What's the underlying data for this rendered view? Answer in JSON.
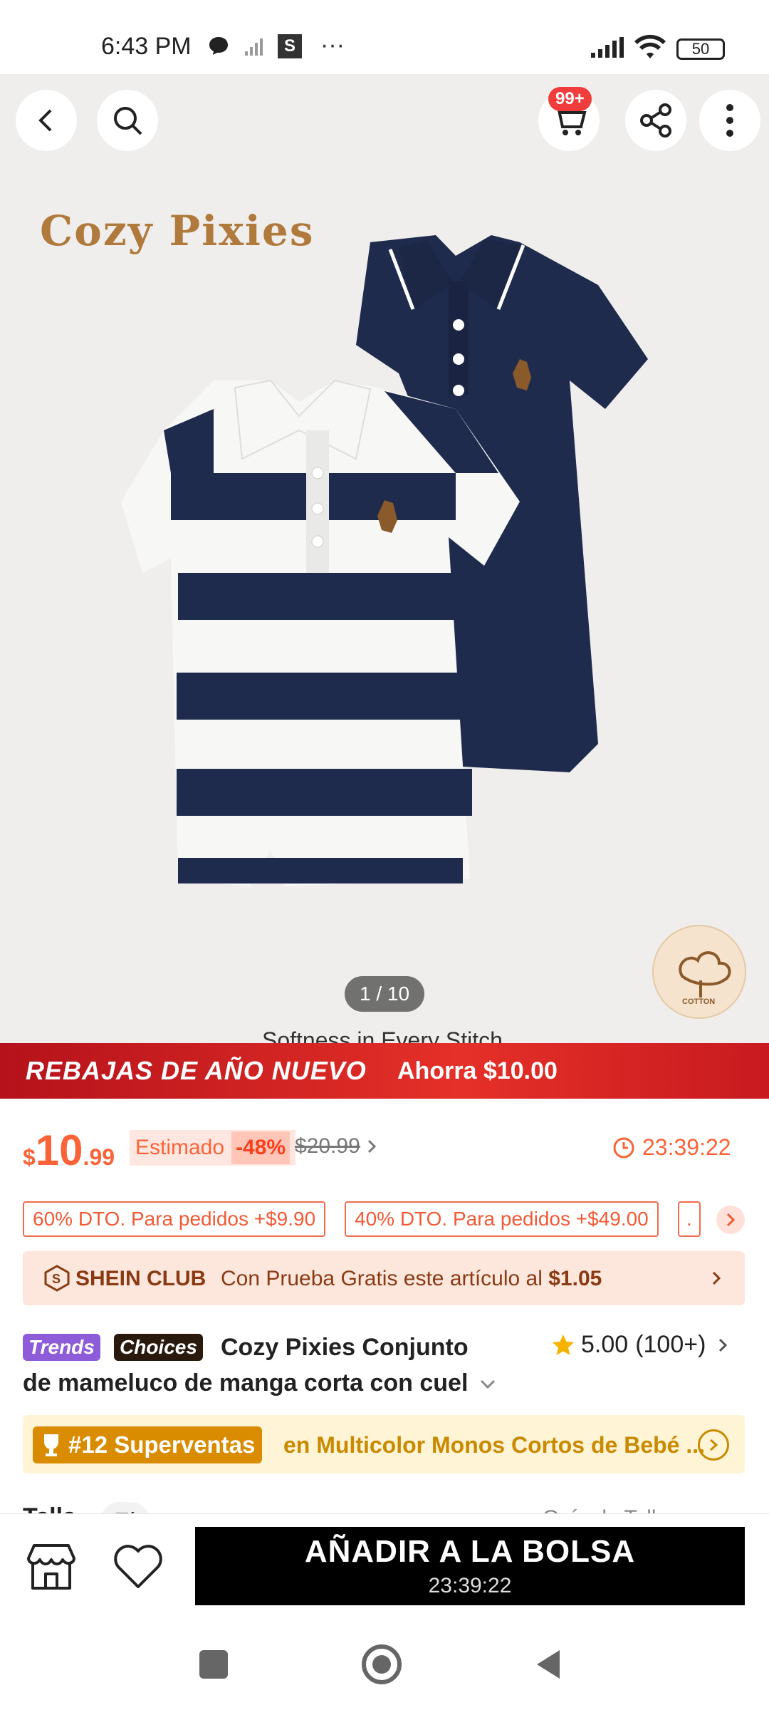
{
  "status_bar": {
    "time": "6:43 PM",
    "s_badge": "S",
    "dots": "···",
    "battery": "50"
  },
  "header": {
    "cart_badge": "99+"
  },
  "hero": {
    "brand_logo_text": "Cozy Pixies",
    "pager": "1 / 10",
    "caption": "Softness in Every Stitch",
    "cotton_label": "COTTON",
    "colors": {
      "navy": "#1f2b4d",
      "white": "#f7f7f5",
      "bg": "#efeeec"
    }
  },
  "promo": {
    "title": "REBAJAS DE AÑO NUEVO",
    "saving": "Ahorra $10.00"
  },
  "price": {
    "currency": "$",
    "integer": "10",
    "decimal": ".99",
    "estimated_label": "Estimado",
    "discount": "-48%",
    "original": "$20.99",
    "timer": "23:39:22"
  },
  "coupons": [
    {
      "label": "60% DTO. Para pedidos +$9.90"
    },
    {
      "label": "40% DTO. Para pedidos +$49.00"
    },
    {
      "label": "."
    }
  ],
  "club": {
    "label": "SHEIN CLUB",
    "text_prefix": "Con Prueba Gratis este artículo al ",
    "text_price": "$1.05"
  },
  "title": {
    "tag_trends": "Trends",
    "tag_choices": "Choices",
    "line1": "Cozy Pixies Conjunto",
    "line2": "de mameluco de manga corta con cuel",
    "rating": "5.00",
    "rating_count": "(100+)"
  },
  "bestseller": {
    "rank": "#12 Superventas",
    "category": "en Multicolor Monos Cortos de Bebé ..."
  },
  "partial_row": {
    "left": "Talla",
    "pill": "Tí",
    "right": "Guía de Talla"
  },
  "bottom": {
    "add_label": "AÑADIR A LA BOLSA",
    "add_timer": "23:39:22"
  }
}
